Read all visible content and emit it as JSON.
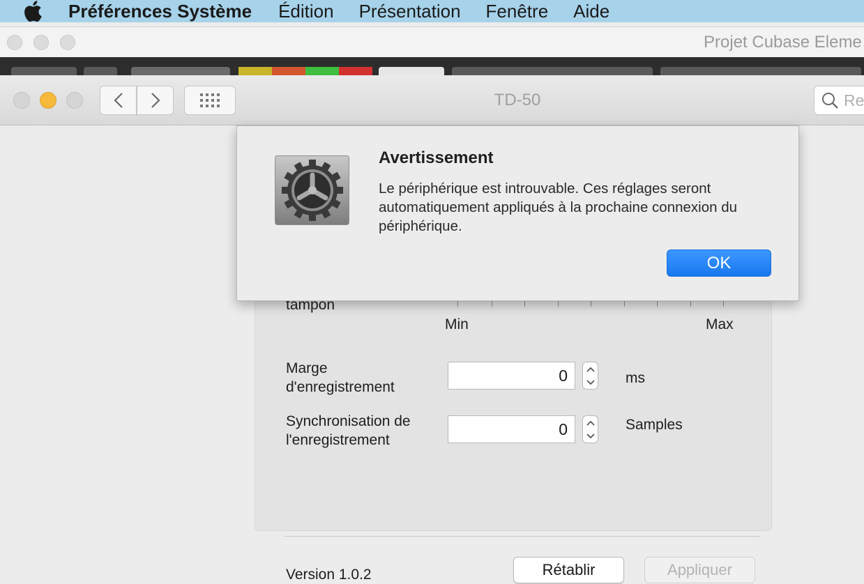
{
  "menubar": {
    "app_name": "Préférences Système",
    "items": [
      "Édition",
      "Présentation",
      "Fenêtre",
      "Aide"
    ]
  },
  "background_window": {
    "title": "Projet Cubase Eleme"
  },
  "window": {
    "title": "TD-50",
    "search_placeholder": "Re"
  },
  "panel": {
    "buffer_label": "tampon",
    "slider_min": "Min",
    "slider_max": "Max",
    "record_margin_label": "Marge d'enregistrement",
    "record_margin_value": "0",
    "record_margin_unit": "ms",
    "record_sync_label": "Synchronisation de l'enregistrement",
    "record_sync_value": "0",
    "record_sync_unit": "Samples",
    "version": "Version 1.0.2",
    "reset_label": "Rétablir",
    "apply_label": "Appliquer"
  },
  "alert": {
    "title": "Avertissement",
    "message": "Le périphérique est introuvable. Ces réglages seront automatiquement appliqués à la prochaine connexion du périphérique.",
    "ok_label": "OK",
    "icon": "gear-icon"
  },
  "colors": {
    "menubar_bg": "#a6d2ea",
    "accent_button": "#1a78f0",
    "minimize_light": "#f6b93b"
  }
}
